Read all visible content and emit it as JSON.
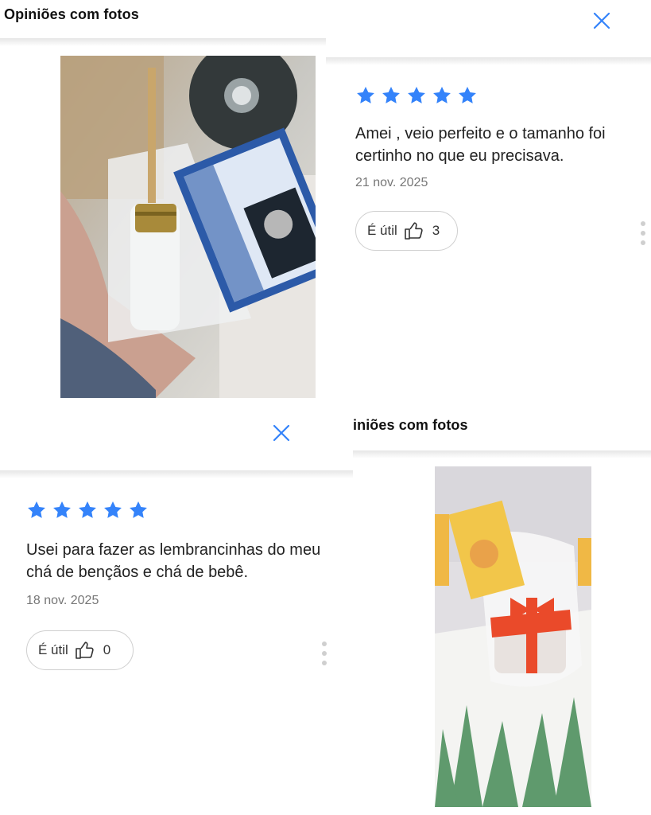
{
  "panel_top_left": {
    "title": "Opiniões com fotos"
  },
  "panel_bottom_right": {
    "title": "iniões com fotos"
  },
  "review_1": {
    "stars": 5,
    "text": "Amei , veio perfeito e o tamanho foi certinho no que eu precisava.",
    "date": "21 nov. 2025",
    "helpful_label": "É útil",
    "helpful_count": "3"
  },
  "review_2": {
    "stars": 5,
    "text": "Usei para fazer as lembrancinhas do meu chá de bençãos e chá de bebê.",
    "date": "18 nov. 2025",
    "helpful_label": "É útil",
    "helpful_count": "0"
  },
  "colors": {
    "star": "#3483fa",
    "close": "#3483fa",
    "border": "#cfcfcf"
  },
  "icons": [
    "close-icon",
    "star-icon",
    "thumbs-up-icon",
    "more-options-icon"
  ]
}
